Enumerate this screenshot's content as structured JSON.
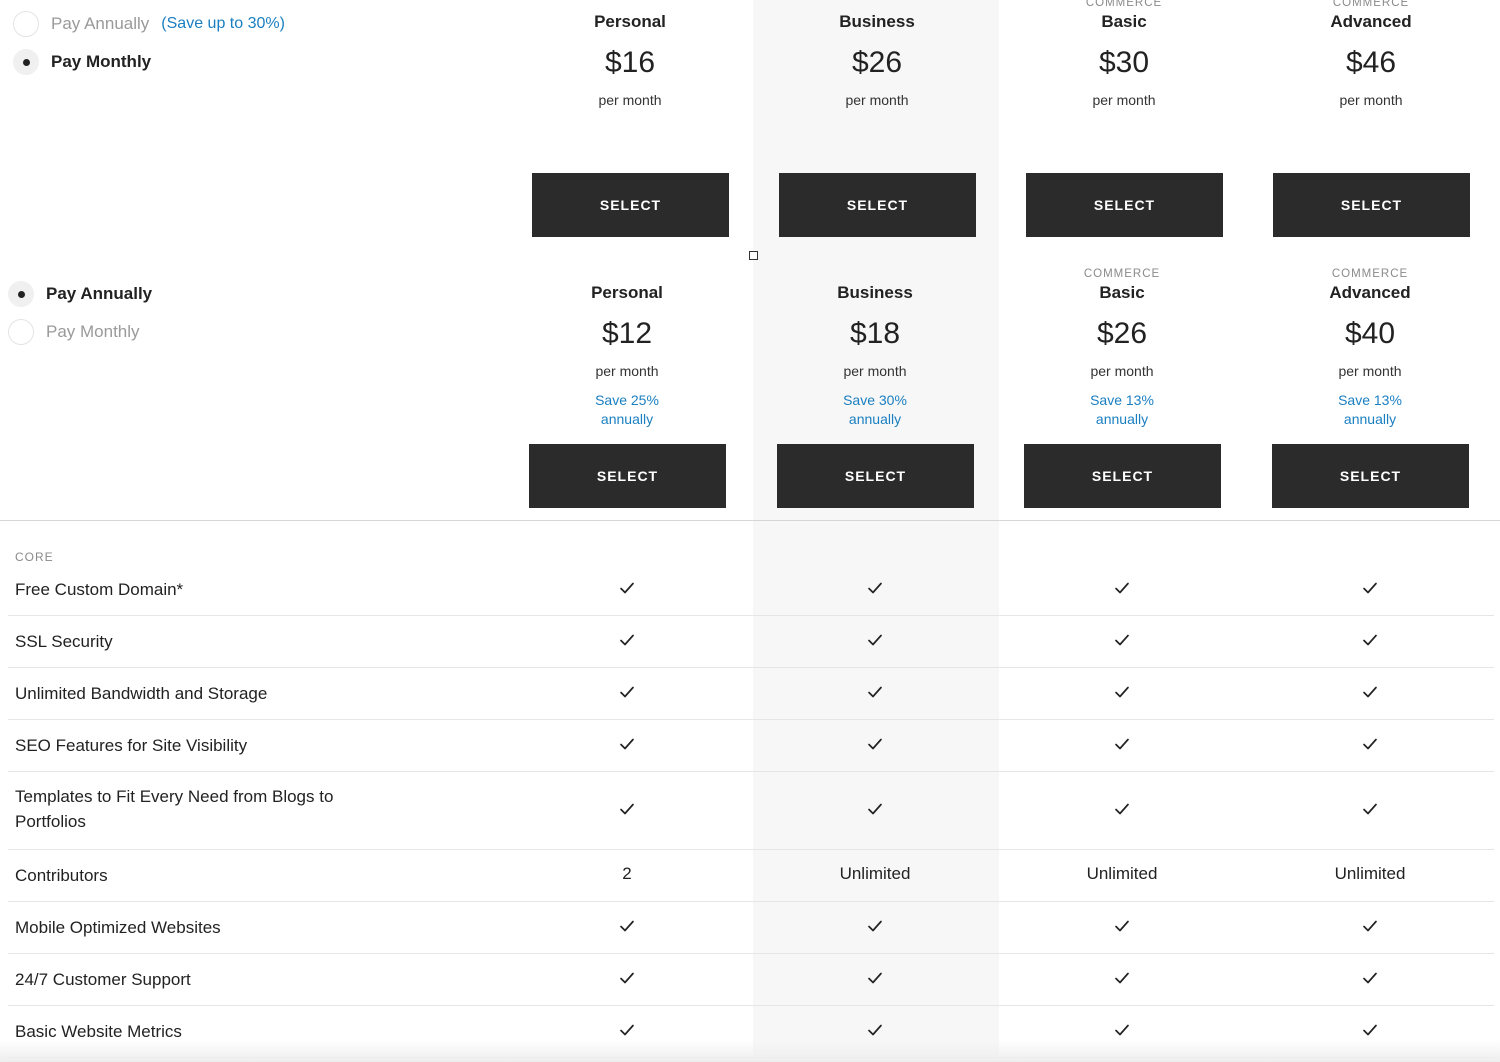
{
  "monthly_section": {
    "toggle": {
      "annually_label": "Pay Annually",
      "annually_note": "(Save up to 30%)",
      "monthly_label": "Pay Monthly",
      "selected": "monthly"
    },
    "plans": [
      {
        "tag": "",
        "name": "Personal",
        "price": "$16",
        "period": "per month",
        "button": "SELECT"
      },
      {
        "tag": "",
        "name": "Business",
        "price": "$26",
        "period": "per month",
        "button": "SELECT"
      },
      {
        "tag": "COMMERCE",
        "name": "Basic",
        "price": "$30",
        "period": "per month",
        "button": "SELECT"
      },
      {
        "tag": "COMMERCE",
        "name": "Advanced",
        "price": "$46",
        "period": "per month",
        "button": "SELECT"
      }
    ]
  },
  "annual_section": {
    "toggle": {
      "annually_label": "Pay Annually",
      "monthly_label": "Pay Monthly",
      "selected": "annually"
    },
    "plans": [
      {
        "tag": "",
        "name": "Personal",
        "price": "$12",
        "period": "per month",
        "save_line1": "Save 25%",
        "save_line2": "annually",
        "button": "SELECT"
      },
      {
        "tag": "",
        "name": "Business",
        "price": "$18",
        "period": "per month",
        "save_line1": "Save 30%",
        "save_line2": "annually",
        "button": "SELECT"
      },
      {
        "tag": "COMMERCE",
        "name": "Basic",
        "price": "$26",
        "period": "per month",
        "save_line1": "Save 13%",
        "save_line2": "annually",
        "button": "SELECT"
      },
      {
        "tag": "COMMERCE",
        "name": "Advanced",
        "price": "$40",
        "period": "per month",
        "save_line1": "Save 13%",
        "save_line2": "annually",
        "button": "SELECT"
      }
    ]
  },
  "features": {
    "section_label": "CORE",
    "rows": [
      {
        "name": "Free Custom Domain*",
        "values": [
          "check",
          "check",
          "check",
          "check"
        ]
      },
      {
        "name": "SSL Security",
        "values": [
          "check",
          "check",
          "check",
          "check"
        ]
      },
      {
        "name": "Unlimited Bandwidth and Storage",
        "values": [
          "check",
          "check",
          "check",
          "check"
        ]
      },
      {
        "name": "SEO Features for Site Visibility",
        "values": [
          "check",
          "check",
          "check",
          "check"
        ]
      },
      {
        "name": "Templates to Fit Every Need from Blogs to Portfolios",
        "values": [
          "check",
          "check",
          "check",
          "check"
        ]
      },
      {
        "name": "Contributors",
        "values": [
          "2",
          "Unlimited",
          "Unlimited",
          "Unlimited"
        ]
      },
      {
        "name": "Mobile Optimized Websites",
        "values": [
          "check",
          "check",
          "check",
          "check"
        ]
      },
      {
        "name": "24/7 Customer Support",
        "values": [
          "check",
          "check",
          "check",
          "check"
        ]
      },
      {
        "name": "Basic Website Metrics",
        "values": [
          "check",
          "check",
          "check",
          "check"
        ]
      }
    ]
  },
  "colors": {
    "accent": "#1a7fc1",
    "button_bg": "#2b2b2b",
    "highlight_column": "#f7f7f7"
  },
  "icons": {
    "check": "check-icon",
    "radio": "radio-icon"
  }
}
